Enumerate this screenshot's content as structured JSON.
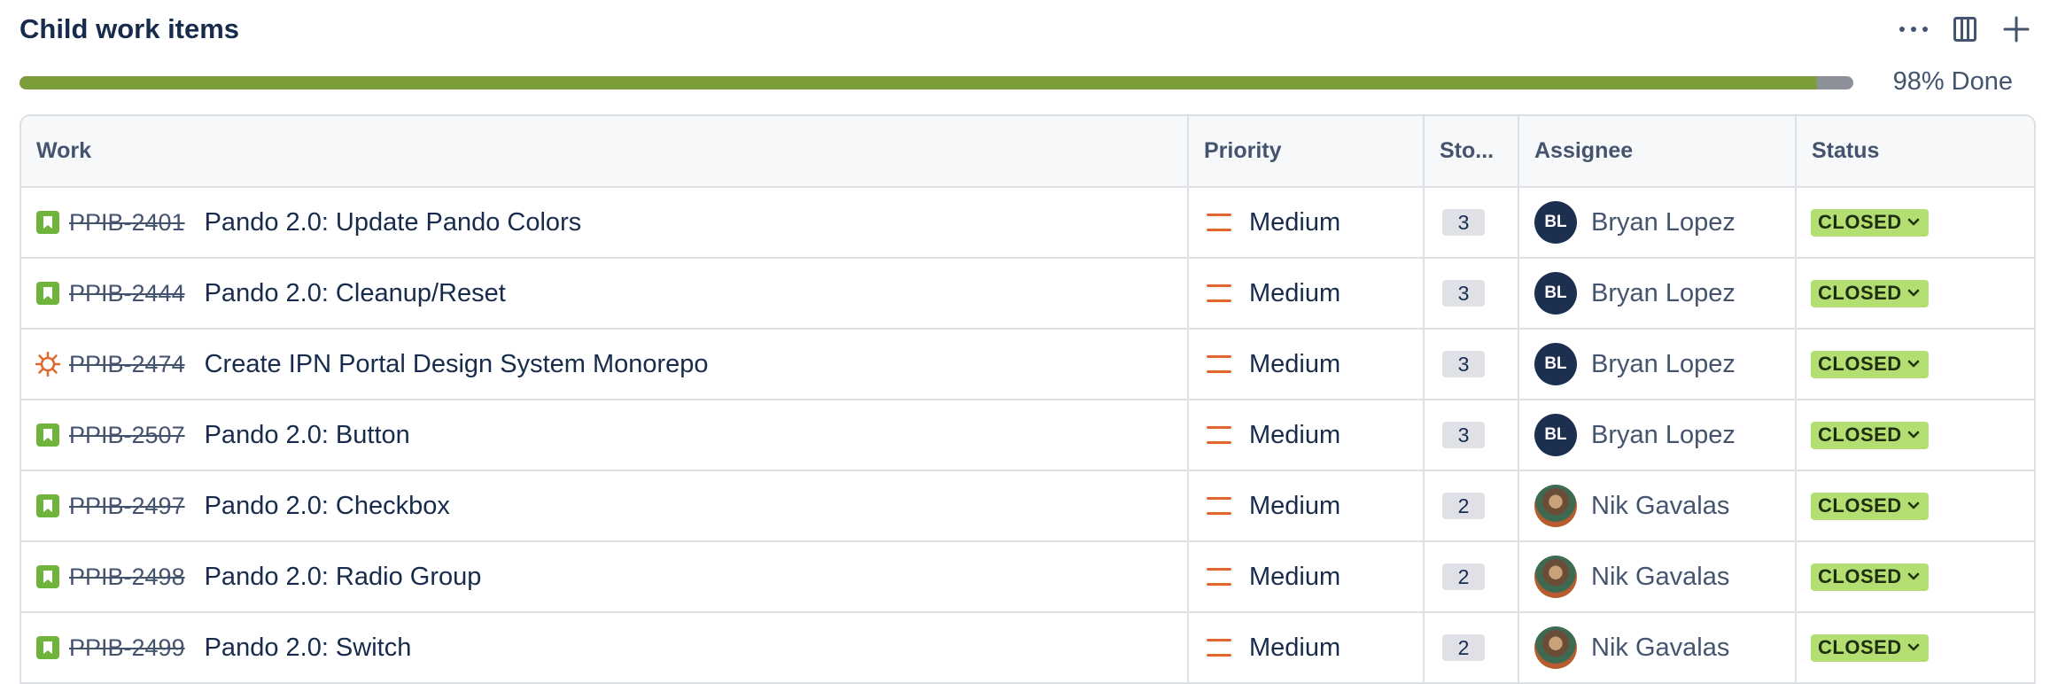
{
  "header": {
    "title": "Child work items",
    "actions": [
      {
        "icon": "more-icon"
      },
      {
        "icon": "columns-icon"
      },
      {
        "icon": "plus-icon"
      }
    ]
  },
  "progress": {
    "percent": 98,
    "label": "98% Done",
    "done_color": "#7b9e3a",
    "remaining_color": "#8d8f99"
  },
  "table": {
    "columns": [
      "Work",
      "Priority",
      "Sto...",
      "Assignee",
      "Status"
    ],
    "rows": [
      {
        "type": "story",
        "key": "PPIB-2401",
        "summary": "Pando 2.0: Update Pando Colors",
        "priority": "Medium",
        "story_points": "3",
        "assignee": "Bryan Lopez",
        "initials": "BL",
        "avatar": "initials",
        "status": "CLOSED"
      },
      {
        "type": "story",
        "key": "PPIB-2444",
        "summary": "Pando 2.0: Cleanup/Reset",
        "priority": "Medium",
        "story_points": "3",
        "assignee": "Bryan Lopez",
        "initials": "BL",
        "avatar": "initials",
        "status": "CLOSED"
      },
      {
        "type": "bug",
        "key": "PPIB-2474",
        "summary": "Create IPN Portal Design System Monorepo",
        "priority": "Medium",
        "story_points": "3",
        "assignee": "Bryan Lopez",
        "initials": "BL",
        "avatar": "initials",
        "status": "CLOSED"
      },
      {
        "type": "story",
        "key": "PPIB-2507",
        "summary": "Pando 2.0: Button",
        "priority": "Medium",
        "story_points": "3",
        "assignee": "Bryan Lopez",
        "initials": "BL",
        "avatar": "initials",
        "status": "CLOSED"
      },
      {
        "type": "story",
        "key": "PPIB-2497",
        "summary": "Pando 2.0: Checkbox",
        "priority": "Medium",
        "story_points": "2",
        "assignee": "Nik Gavalas",
        "initials": "",
        "avatar": "photo",
        "status": "CLOSED"
      },
      {
        "type": "story",
        "key": "PPIB-2498",
        "summary": "Pando 2.0: Radio Group",
        "priority": "Medium",
        "story_points": "2",
        "assignee": "Nik Gavalas",
        "initials": "",
        "avatar": "photo",
        "status": "CLOSED"
      },
      {
        "type": "story",
        "key": "PPIB-2499",
        "summary": "Pando 2.0: Switch",
        "priority": "Medium",
        "story_points": "2",
        "assignee": "Nik Gavalas",
        "initials": "",
        "avatar": "photo",
        "status": "CLOSED"
      }
    ]
  },
  "colors": {
    "story_icon": "#6fb33d",
    "bug_icon": "#e2672c",
    "priority_medium": "#e2672c",
    "status_closed_bg": "#b3df72",
    "avatar_bg": "#1d2f4e"
  }
}
